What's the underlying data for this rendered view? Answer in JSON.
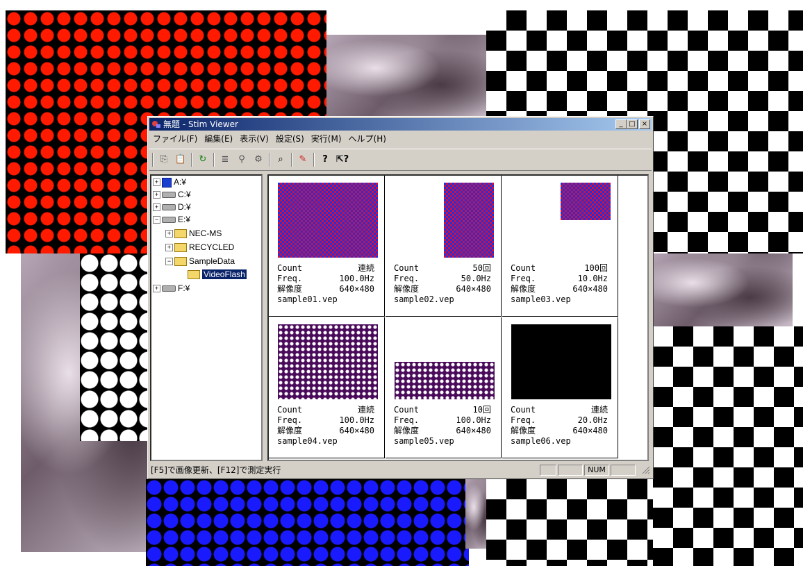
{
  "window": {
    "title": "無題 - Stim Viewer",
    "buttons": {
      "minimize": "_",
      "maximize": "□",
      "close": "×"
    }
  },
  "menu": [
    "ファイル(F)",
    "編集(E)",
    "表示(V)",
    "設定(S)",
    "実行(M)",
    "ヘルプ(H)"
  ],
  "toolbar": {
    "icons": [
      "copy-icon",
      "paste-icon",
      "refresh-icon",
      "list-icon",
      "find-icon",
      "properties-icon",
      "binoculars-icon",
      "brush-icon",
      "help-icon",
      "context-help-icon"
    ],
    "glyphs": [
      "⎘",
      "📋",
      "↻",
      "≣",
      "⚲",
      "⚙",
      "⌕",
      "✎",
      "?",
      "⇱?"
    ]
  },
  "tree": {
    "items": [
      {
        "label": "A:¥",
        "expander": "+",
        "icon": "floppy-icon"
      },
      {
        "label": "C:¥",
        "expander": "+",
        "icon": "drive-icon"
      },
      {
        "label": "D:¥",
        "expander": "+",
        "icon": "drive-icon"
      },
      {
        "label": "E:¥",
        "expander": "−",
        "icon": "drive-icon"
      },
      {
        "label": "NEC-MS",
        "expander": "+",
        "icon": "folder-icon"
      },
      {
        "label": "RECYCLED",
        "expander": "+",
        "icon": "folder-icon"
      },
      {
        "label": "SampleData",
        "expander": "−",
        "icon": "folder-icon"
      },
      {
        "label": "VideoFlash",
        "expander": "",
        "icon": "folder-open-icon",
        "selected": true
      },
      {
        "label": "F:¥",
        "expander": "+",
        "icon": "drive-icon"
      }
    ]
  },
  "labels": {
    "count": "Count",
    "freq": "Freq.",
    "resolution": "解像度"
  },
  "samples": [
    {
      "count": "連続",
      "freq": "100.0Hz",
      "resolution": "640×480",
      "file": "sample01.vep",
      "pattern": "checker"
    },
    {
      "count": "50回",
      "freq": "50.0Hz",
      "resolution": "640×480",
      "file": "sample02.vep",
      "pattern": "checker"
    },
    {
      "count": "100回",
      "freq": "10.0Hz",
      "resolution": "640×480",
      "file": "sample03.vep",
      "pattern": "checker"
    },
    {
      "count": "連続",
      "freq": "100.0Hz",
      "resolution": "640×480",
      "file": "sample04.vep",
      "pattern": "dots"
    },
    {
      "count": "10回",
      "freq": "100.0Hz",
      "resolution": "640×480",
      "file": "sample05.vep",
      "pattern": "dots"
    },
    {
      "count": "連続",
      "freq": "20.0Hz",
      "resolution": "640×480",
      "file": "sample06.vep",
      "pattern": "black"
    }
  ],
  "status": {
    "text": "[F5]で画像更新、[F12]で測定実行",
    "num": "NUM"
  }
}
